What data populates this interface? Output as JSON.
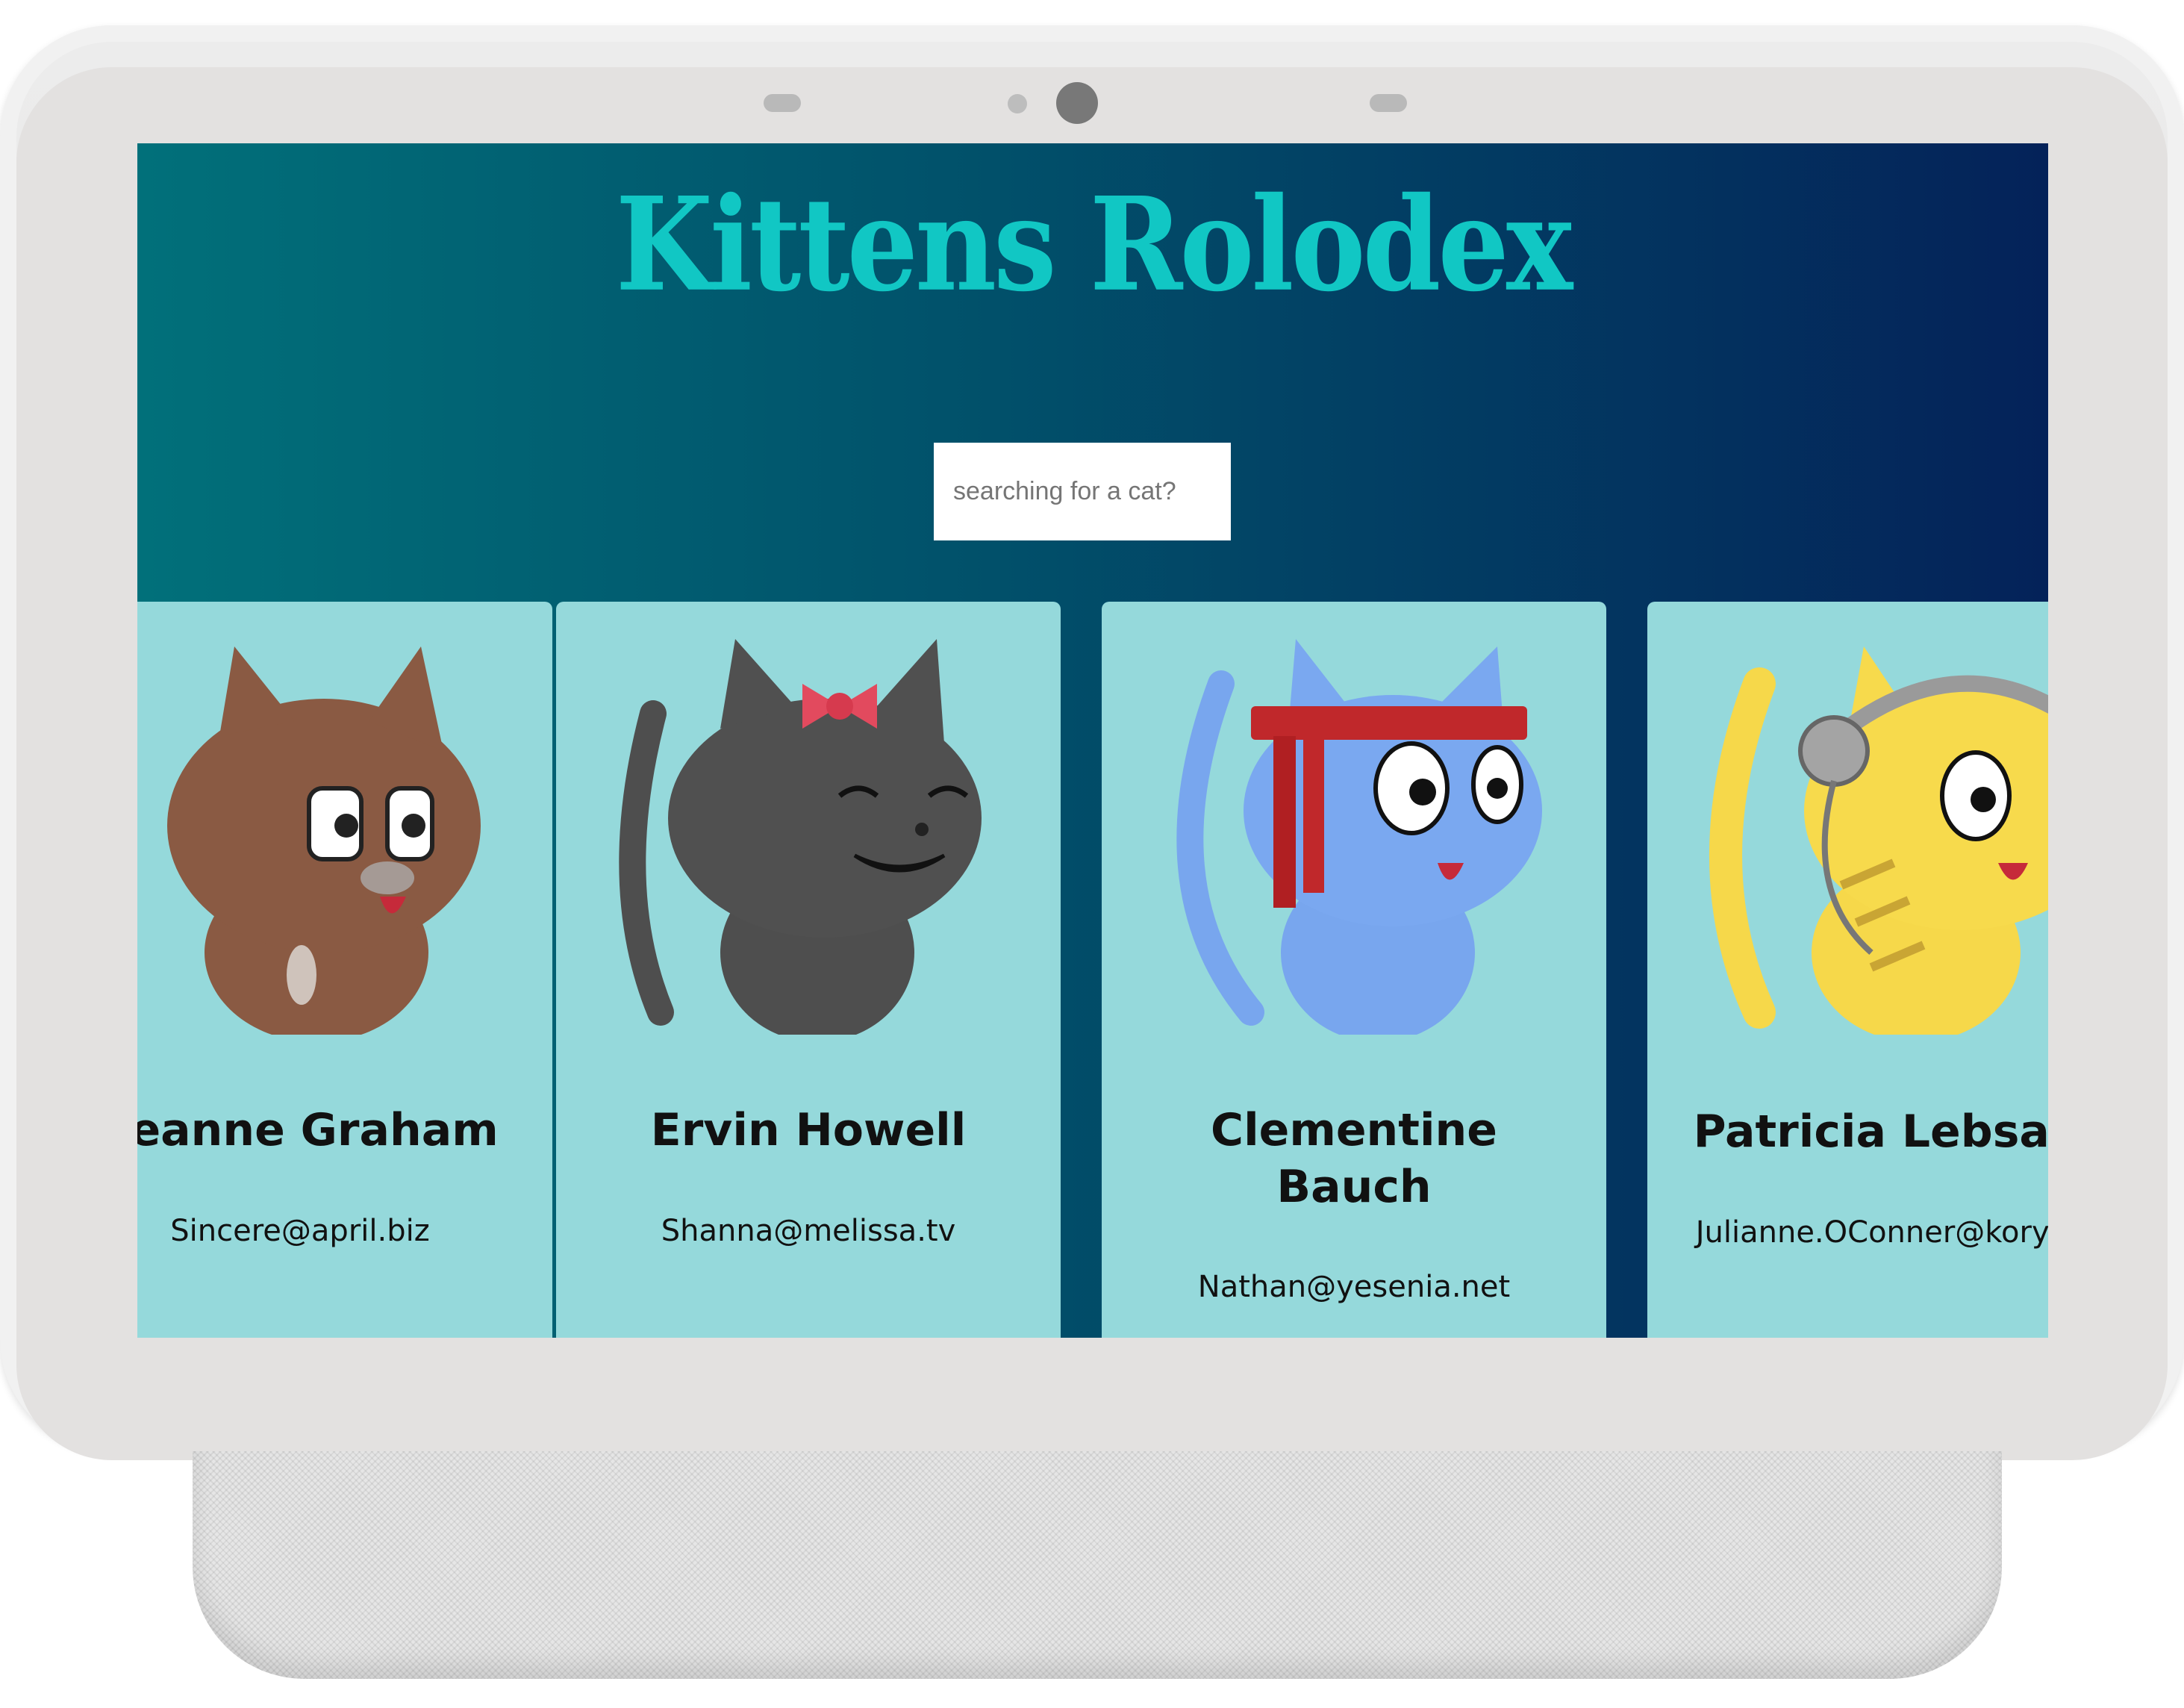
{
  "app": {
    "title": "Kittens Rolodex",
    "search": {
      "placeholder": "searching for a cat?",
      "value": ""
    }
  },
  "cards": [
    {
      "name": "Leanne Graham",
      "email": "Sincere@april.biz",
      "fur": "#8a5a43"
    },
    {
      "name": "Ervin Howell",
      "email": "Shanna@melissa.tv",
      "fur": "#4e4e4e"
    },
    {
      "name": "Clementine Bauch",
      "email": "Nathan@yesenia.net",
      "fur": "#78a6ee"
    },
    {
      "name": "Patricia Lebsack",
      "email": "Julianne.OConner@kory.org",
      "fur": "#f6d84a"
    }
  ],
  "colors": {
    "background_start": "#01707a",
    "background_end": "#042259",
    "title": "#11c7c4",
    "card": "#95d9db"
  }
}
